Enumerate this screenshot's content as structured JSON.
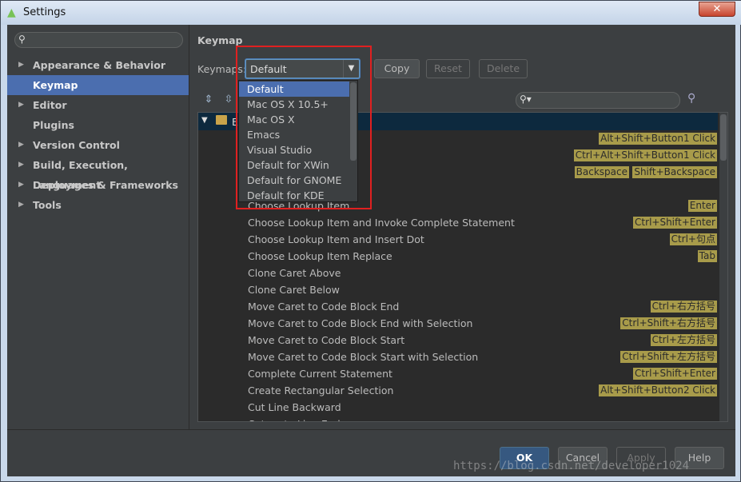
{
  "window": {
    "title": "Settings",
    "close_glyph": "✕"
  },
  "sidebar": {
    "items": [
      {
        "label": "Appearance & Behavior",
        "expandable": true
      },
      {
        "label": "Keymap",
        "expandable": false,
        "selected": true
      },
      {
        "label": "Editor",
        "expandable": true
      },
      {
        "label": "Plugins",
        "expandable": false
      },
      {
        "label": "Version Control",
        "expandable": true
      },
      {
        "label": "Build, Execution, Deployment",
        "expandable": true
      },
      {
        "label": "Languages & Frameworks",
        "expandable": true
      },
      {
        "label": "Tools",
        "expandable": true
      }
    ]
  },
  "main": {
    "section_title": "Keymap",
    "keymaps_label": "Keymaps:",
    "keymap_value": "Default",
    "copy_label": "Copy",
    "reset_label": "Reset",
    "delete_label": "Delete",
    "tree_root_label": "Ed"
  },
  "dropdown": {
    "options": [
      "Default",
      "Mac OS X 10.5+",
      "Mac OS X",
      "Emacs",
      "Visual Studio",
      "Default for XWin",
      "Default for GNOME",
      "Default for KDE"
    ]
  },
  "actions": [
    {
      "label": "",
      "shortcuts": [
        "Alt+Shift+Button1 Click"
      ]
    },
    {
      "label": "on on Mouse Drag",
      "shortcuts": [
        "Ctrl+Alt+Shift+Button1 Click"
      ]
    },
    {
      "label": "",
      "shortcuts": [
        "Backspace",
        "Shift+Backspace"
      ]
    },
    {
      "label": "Paragraph",
      "shortcuts": []
    },
    {
      "label": "Choose Lookup Item",
      "shortcuts": [
        "Enter"
      ]
    },
    {
      "label": "Choose Lookup Item and Invoke Complete Statement",
      "shortcuts": [
        "Ctrl+Shift+Enter"
      ]
    },
    {
      "label": "Choose Lookup Item and Insert Dot",
      "shortcuts": [
        "Ctrl+句点"
      ]
    },
    {
      "label": "Choose Lookup Item Replace",
      "shortcuts": [
        "Tab"
      ]
    },
    {
      "label": "Clone Caret Above",
      "shortcuts": []
    },
    {
      "label": "Clone Caret Below",
      "shortcuts": []
    },
    {
      "label": "Move Caret to Code Block End",
      "shortcuts": [
        "Ctrl+右方括号"
      ]
    },
    {
      "label": "Move Caret to Code Block End with Selection",
      "shortcuts": [
        "Ctrl+Shift+右方括号"
      ]
    },
    {
      "label": "Move Caret to Code Block Start",
      "shortcuts": [
        "Ctrl+左方括号"
      ]
    },
    {
      "label": "Move Caret to Code Block Start with Selection",
      "shortcuts": [
        "Ctrl+Shift+左方括号"
      ]
    },
    {
      "label": "Complete Current Statement",
      "shortcuts": [
        "Ctrl+Shift+Enter"
      ]
    },
    {
      "label": "Create Rectangular Selection",
      "shortcuts": [
        "Alt+Shift+Button2 Click"
      ]
    },
    {
      "label": "Cut Line Backward",
      "shortcuts": []
    },
    {
      "label": "Cut up to Line End",
      "shortcuts": []
    }
  ],
  "footer": {
    "ok": "OK",
    "cancel": "Cancel",
    "apply": "Apply",
    "help": "Help"
  },
  "watermark": "https://blog.csdn.net/developer1024",
  "colors": {
    "selection": "#4b6eaf",
    "shortcut_badge": "#a89b4a",
    "highlight_box": "#e02020"
  }
}
